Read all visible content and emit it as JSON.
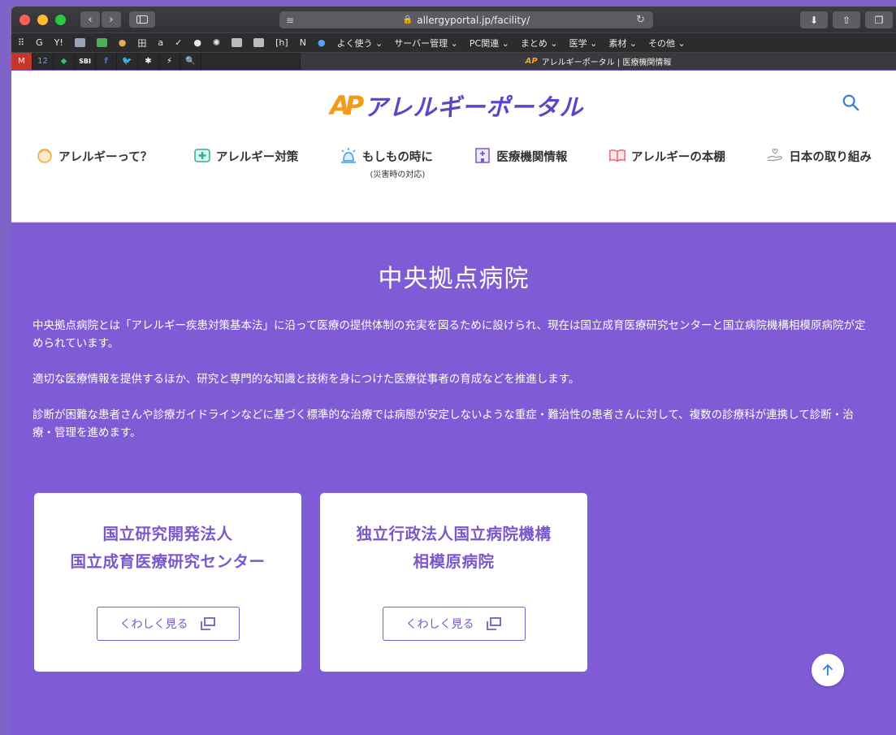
{
  "browser": {
    "url": "allergyportal.jp/facility/",
    "tab_title": "アレルギーポータル | 医療機関情報",
    "tab_icon_text": "AP",
    "bookmarks": [
      "G",
      "Y!",
      "田",
      "a",
      "[h]",
      "N",
      "よく使う ⌄",
      "サーバー管理 ⌄",
      "PC関連 ⌄",
      "まとめ ⌄",
      "医学 ⌄",
      "素材 ⌄",
      "その他 ⌄"
    ],
    "pinned_tabs": [
      "M",
      "12",
      "◆",
      "SBI",
      "f",
      "🐦",
      "✱",
      "⚡",
      "🔍"
    ]
  },
  "header": {
    "logo_mark": "AP",
    "logo_text": "アレルギーポータル"
  },
  "nav": [
    {
      "label": "アレルギーって？",
      "sub": ""
    },
    {
      "label": "アレルギー対策",
      "sub": ""
    },
    {
      "label": "もしもの時に",
      "sub": "(災害時の対応)"
    },
    {
      "label": "医療機関情報",
      "sub": ""
    },
    {
      "label": "アレルギーの本棚",
      "sub": ""
    },
    {
      "label": "日本の取り組み",
      "sub": ""
    }
  ],
  "main": {
    "title": "中央拠点病院",
    "paragraphs": [
      "中央拠点病院とは「アレルギー疾患対策基本法」に沿って医療の提供体制の充実を図るために設けられ、現在は国立成育医療研究センターと国立病院機構相模原病院が定められています。",
      "適切な医療情報を提供するほか、研究と専門的な知識と技術を身につけた医療従事者の育成などを推進します。",
      "診断が困難な患者さんや診療ガイドラインなどに基づく標準的な治療では病態が安定しないような重症・難治性の患者さんに対して、複数の診療科が連携して診断・治療・管理を進めます。"
    ],
    "cards": [
      {
        "line1": "国立研究開発法人",
        "line2": "国立成育医療研究センター",
        "button": "くわしく見る"
      },
      {
        "line1": "独立行政法人国立病院機構",
        "line2": "相模原病院",
        "button": "くわしく見る"
      }
    ]
  },
  "colors": {
    "brand_purple": "#7f5bd6",
    "logo_orange": "#f39a1b",
    "logo_purple": "#5b46c8"
  }
}
